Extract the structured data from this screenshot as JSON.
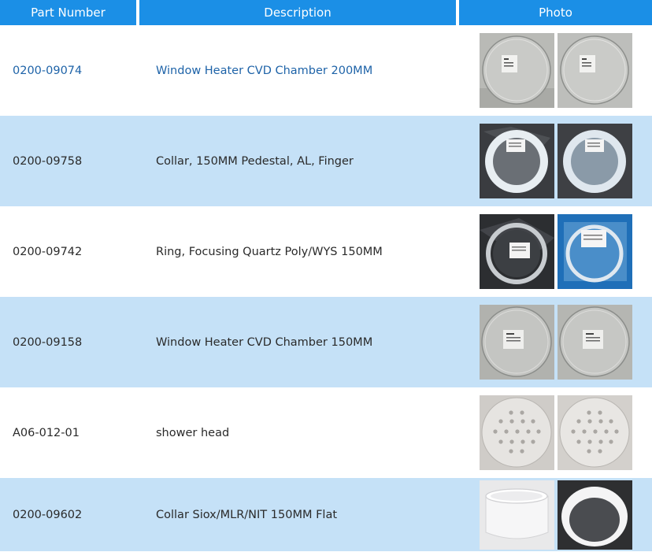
{
  "headers": {
    "part_number": "Part Number",
    "description": "Description",
    "photo": "Photo"
  },
  "colors": {
    "header_bg": "#1b8fe6",
    "alt_row_bg": "#c5e1f7",
    "link_text": "#1e63a8"
  },
  "rows": [
    {
      "part": "0200-09074",
      "desc": "Window Heater CVD Chamber 200MM",
      "photo_type": "quartz-disc-with-label",
      "linked": true
    },
    {
      "part": "0200-09758",
      "desc": "Collar, 150MM Pedestal, AL, Finger",
      "photo_type": "white-collar-ring-in-bag",
      "linked": false
    },
    {
      "part": "0200-09742",
      "desc": "Ring, Focusing Quartz Poly/WYS 150MM",
      "photo_type": "clear-ring-in-bag",
      "linked": false
    },
    {
      "part": "0200-09158",
      "desc": "Window Heater CVD Chamber 150MM",
      "photo_type": "quartz-disc-with-label",
      "linked": false
    },
    {
      "part": "A06-012-01",
      "desc": "shower head",
      "photo_type": "perforated-plate",
      "linked": false
    },
    {
      "part": "0200-09602",
      "desc": "Collar Siox/MLR/NIT 150MM Flat",
      "photo_type": "white-cylinder-collar",
      "linked": false
    }
  ]
}
